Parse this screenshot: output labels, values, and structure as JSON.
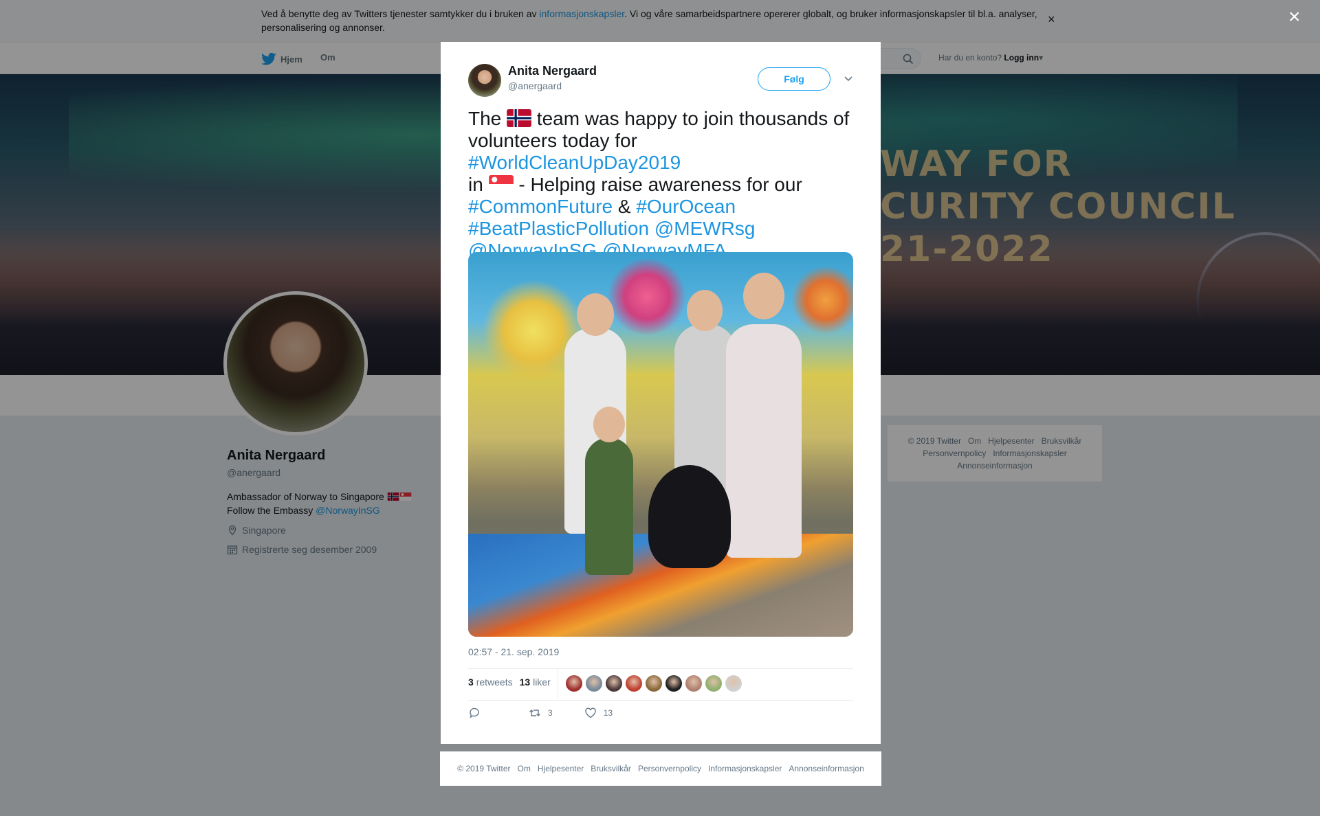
{
  "cookie": {
    "text_before": "Ved å benytte deg av Twitters tjenester samtykker du i bruken av ",
    "link": "informasjonskapsler",
    "text_after": ". Vi og våre samarbeidspartnere opererer globalt, og bruker informasjonskapsler til bl.a. analyser, personalisering og annonser.",
    "close": "×"
  },
  "nav": {
    "home": "Hjem",
    "about": "Om",
    "account_prompt": "Har du en konto?",
    "login": "Logg inn"
  },
  "banner": {
    "line1": "WAY FOR",
    "line2": "CURITY COUNCIL",
    "line3": "21-2022"
  },
  "profile": {
    "name": "Anita Nergaard",
    "handle": "@anergaard",
    "bio_line1": "Ambassador of Norway to Singapore",
    "bio_line2_prefix": "Follow the Embassy ",
    "bio_link": "@NorwayInSG",
    "location": "Singapore",
    "joined": "Registrerte seg desember 2009"
  },
  "side_footer": {
    "items": [
      "© 2019 Twitter",
      "Om",
      "Hjelpesenter",
      "Bruksvilkår",
      "Personvernpolicy",
      "Informasjonskapsler",
      "Annonseinformasjon"
    ]
  },
  "overlay": {
    "close": "×"
  },
  "tweet": {
    "author_name": "Anita Nergaard",
    "author_handle": "@anergaard",
    "follow_label": "Følg",
    "text_1": "The ",
    "text_2": " team was happy to join thousands of volunteers today for ",
    "tag_worldcleanup": "#WorldCleanUpDay2019",
    "text_3": "in ",
    "text_4": " - Helping raise awareness for our ",
    "tag_commonfuture": "#CommonFuture",
    "text_amp": " & ",
    "tag_ourocean": "#OurOcean",
    "tag_beatplastic": "#BeatPlasticPollution",
    "mention_mewr": "@MEWRsg",
    "mention_norwayinsg": "@NorwayInSG",
    "mention_norwaymfa": "@NorwayMFA",
    "timestamp": "02:57 - 21. sep. 2019",
    "retweets_count": "3",
    "retweets_label": "retweets",
    "likes_count": "13",
    "likes_label": "liker",
    "action_retweet_count": "3",
    "action_like_count": "13",
    "liker_avatars": [
      "#a03030",
      "#7a8a9a",
      "#4a3a3a",
      "#c04030",
      "#8a6a3a",
      "#202020",
      "#b08070",
      "#90b070",
      "#d0d0d0"
    ]
  },
  "bottom_footer": {
    "items": [
      "© 2019 Twitter",
      "Om",
      "Hjelpesenter",
      "Bruksvilkår",
      "Personvernpolicy",
      "Informasjonskapsler",
      "Annonseinformasjon"
    ]
  },
  "colors": {
    "link": "#1b95e0",
    "follow": "#1da1f2",
    "muted": "#657786"
  }
}
